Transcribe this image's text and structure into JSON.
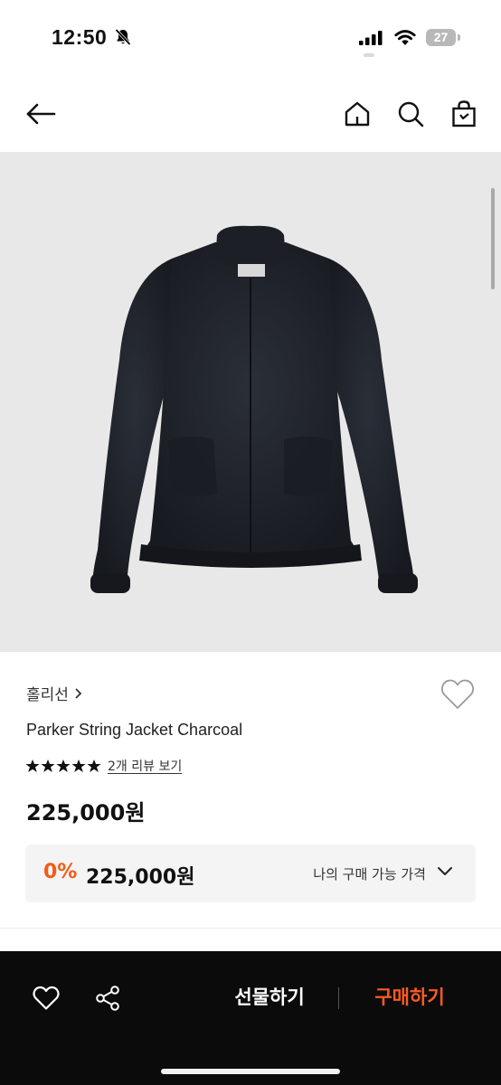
{
  "status_bar": {
    "time": "12:50",
    "battery": "27",
    "icons": [
      "bell-slash-icon",
      "signal-icon",
      "wifi-icon",
      "battery-icon"
    ]
  },
  "nav": {
    "icons": [
      "back-arrow-icon",
      "home-icon",
      "search-icon",
      "shopping-bag-icon"
    ]
  },
  "product": {
    "brand": "홀리선",
    "name": "Parker String Jacket Charcoal",
    "rating": 5,
    "review_link": "2개 리뷰 보기",
    "price": "225,000원",
    "my_price": {
      "discount": "0%",
      "price": "225,000원",
      "label": "나의 구매 가능 가격"
    }
  },
  "bottom_bar": {
    "gift_label": "선물하기",
    "buy_label": "구매하기",
    "icons": [
      "heart-icon",
      "share-icon"
    ]
  },
  "colors": {
    "accent": "#ff5a1f",
    "discount": "#f25c19",
    "bottom_bar_bg": "#0b0b0b",
    "image_bg": "#e9e8e8"
  }
}
